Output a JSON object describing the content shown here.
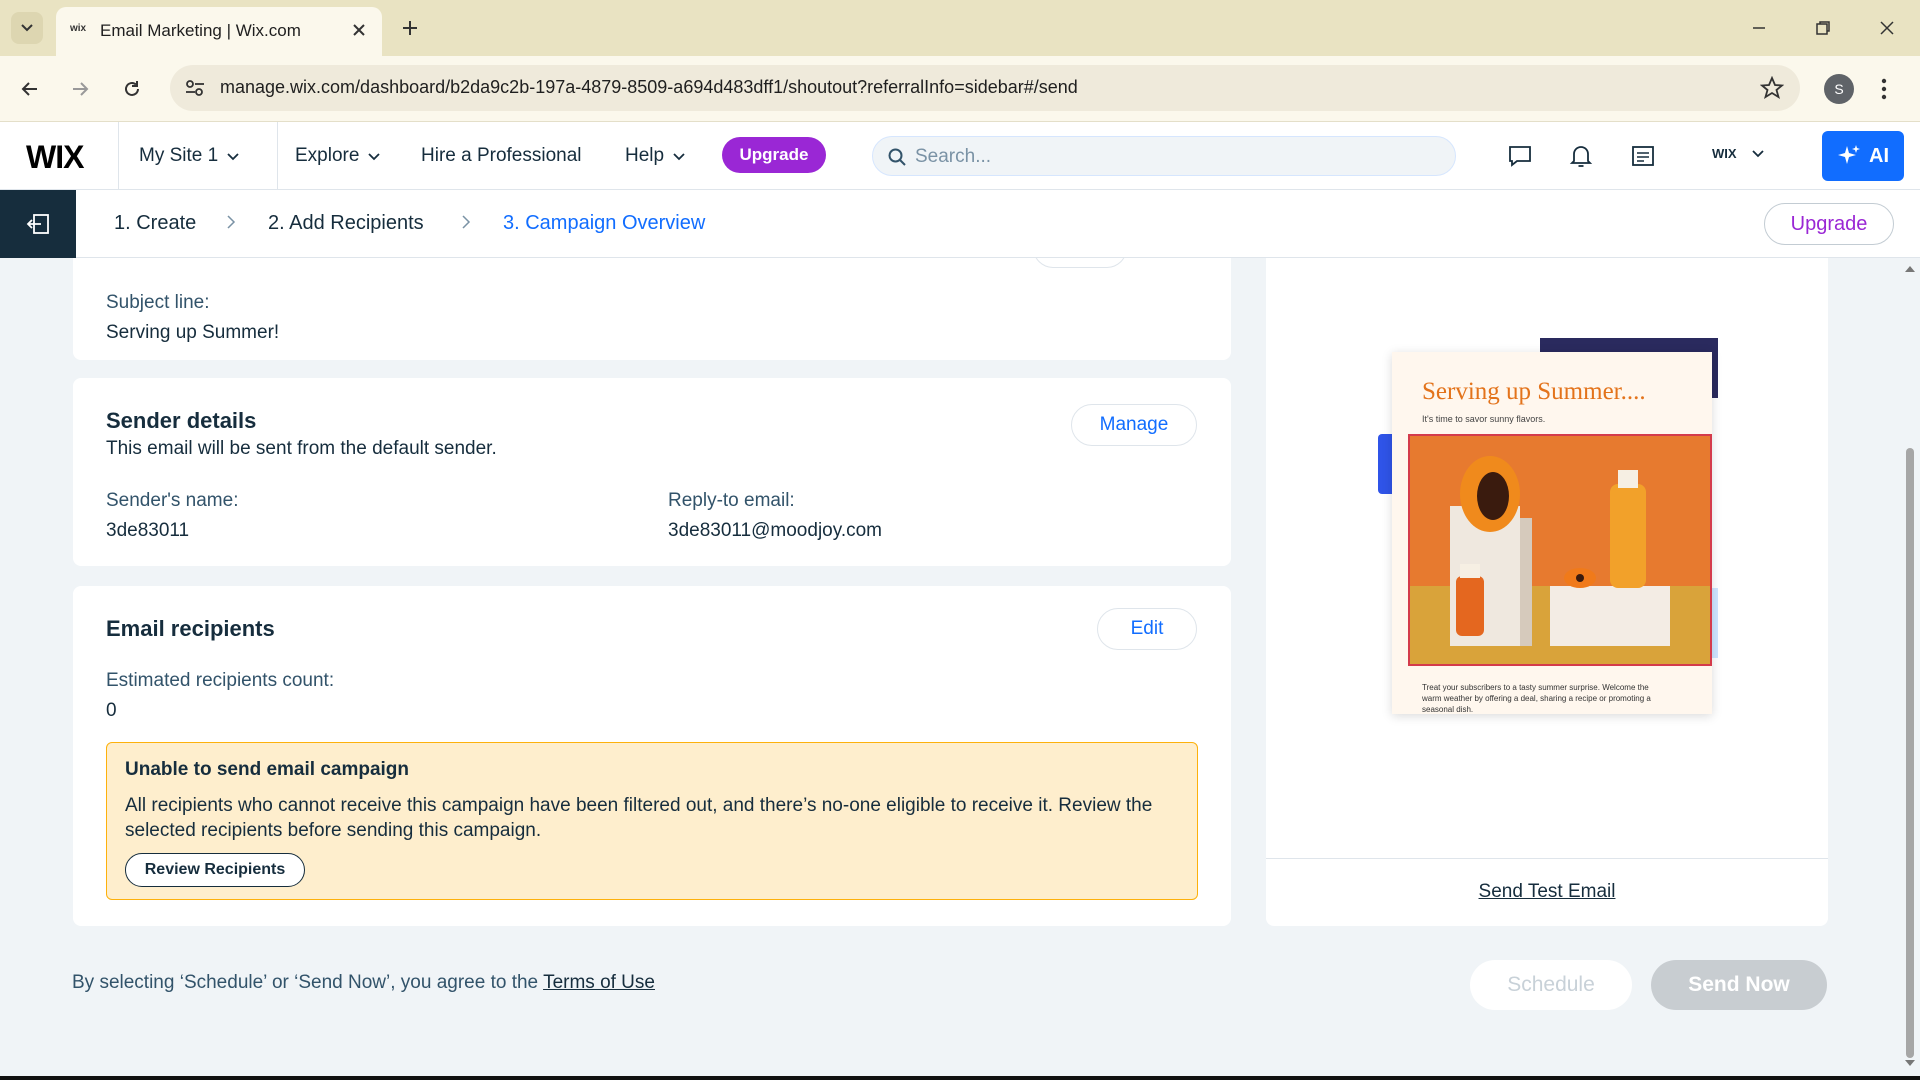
{
  "browser": {
    "tab_title": "Email Marketing | Wix.com",
    "favicon_text": "wix",
    "url": "manage.wix.com/dashboard/b2da9c2b-197a-4879-8509-a694d483dff1/shoutout?referralInfo=sidebar#/send",
    "profile_initial": "S"
  },
  "wix_header": {
    "logo": "WIX",
    "site_selector": "My Site 1",
    "menu": {
      "explore": "Explore",
      "hire": "Hire a Professional",
      "help": "Help"
    },
    "upgrade_label": "Upgrade",
    "search_placeholder": "Search...",
    "account_label": "WIX",
    "ai_label": "AI"
  },
  "steps": {
    "items": [
      "1. Create",
      "2. Add Recipients",
      "3. Campaign Overview"
    ],
    "active_index": 2,
    "upgrade_label": "Upgrade"
  },
  "subject": {
    "label": "Subject line:",
    "value": "Serving up Summer!"
  },
  "sender": {
    "title": "Sender details",
    "description": "This email will be sent from the default sender.",
    "manage_label": "Manage",
    "name_label": "Sender's name:",
    "name_value": "3de83011",
    "reply_label": "Reply-to email:",
    "reply_value": "3de83011@moodjoy.com"
  },
  "recipients": {
    "title": "Email recipients",
    "edit_label": "Edit",
    "count_label": "Estimated recipients count:",
    "count_value": "0",
    "warning": {
      "title": "Unable to send email campaign",
      "body": "All recipients who cannot receive this campaign have been filtered out, and there’s no-one eligible to receive it. Review the selected recipients before sending this campaign.",
      "button": "Review Recipients"
    }
  },
  "preview": {
    "email_title": "Serving up Summer....",
    "email_subtitle": "It's time to savor sunny flavors.",
    "email_footer": "Treat your subscribers to a tasty summer surprise. Welcome the warm weather by offering a deal, sharing a recipe or promoting a seasonal dish.",
    "send_test_label": "Send Test Email"
  },
  "footer": {
    "terms_prefix": "By selecting ‘Schedule’ or ‘Send Now’, you agree to the",
    "terms_link": "Terms of Use",
    "schedule_label": "Schedule",
    "send_now_label": "Send Now"
  },
  "colors": {
    "primary_blue": "#116dff",
    "upgrade_purple": "#9a27d5",
    "warning_bg": "#feeecd",
    "warning_border": "#fdb10c"
  }
}
